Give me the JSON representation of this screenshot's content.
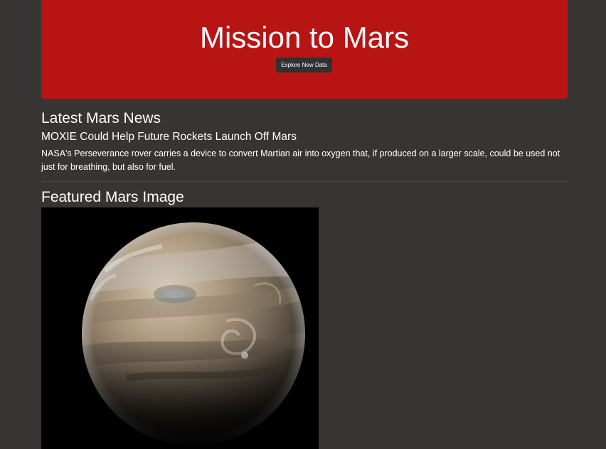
{
  "header": {
    "title": "Mission to Mars",
    "button_label": "Explore New Data",
    "accent_color": "#b81414"
  },
  "news": {
    "heading": "Latest Mars News",
    "title": "MOXIE Could Help Future Rockets Launch Off Mars",
    "teaser": "NASA's Perseverance rover carries a device to convert Martian air into oxygen that, if produced on a larger scale, could be used not just for breathing, but also for fuel."
  },
  "featured_image": {
    "heading": "Featured Mars Image",
    "subject": "planet-photo"
  }
}
